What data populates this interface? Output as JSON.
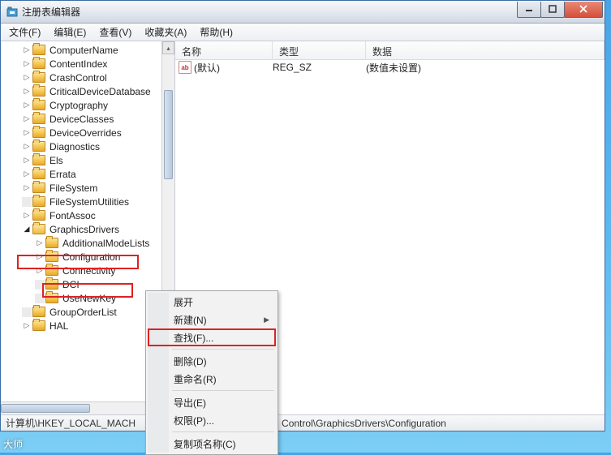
{
  "window": {
    "title": "注册表编辑器"
  },
  "menubar": {
    "file": "文件(F)",
    "edit": "编辑(E)",
    "view": "查看(V)",
    "fav": "收藏夹(A)",
    "help": "帮助(H)"
  },
  "tree": {
    "items": [
      "ComputerName",
      "ContentIndex",
      "CrashControl",
      "CriticalDeviceDatabase",
      "Cryptography",
      "DeviceClasses",
      "DeviceOverrides",
      "Diagnostics",
      "Els",
      "Errata",
      "FileSystem",
      "FileSystemUtilities",
      "FontAssoc",
      "GraphicsDrivers",
      "GroupOrderList",
      "HAL"
    ],
    "gd_children": [
      "AdditionalModeLists",
      "Configuration",
      "Connectivity",
      "DCI",
      "UseNewKey"
    ]
  },
  "list": {
    "cols": {
      "name": "名称",
      "type": "类型",
      "data": "数据"
    },
    "row": {
      "name": "(默认)",
      "type": "REG_SZ",
      "data": "(数值未设置)"
    }
  },
  "context": {
    "expand": "展开",
    "new": "新建(N)",
    "find": "查找(F)...",
    "delete": "删除(D)",
    "rename": "重命名(R)",
    "export": "导出(E)",
    "perm": "权限(P)...",
    "copyname": "复制项名称(C)"
  },
  "status": {
    "left": "计算机\\HKEY_LOCAL_MACH",
    "right": "Control\\GraphicsDrivers\\Configuration"
  },
  "taskbar": "大师"
}
